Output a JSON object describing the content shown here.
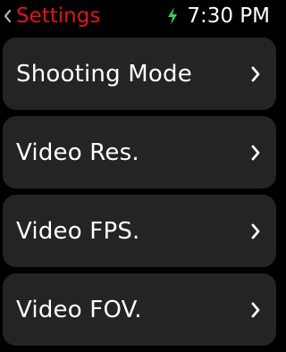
{
  "colors": {
    "background": "#000000",
    "accent": "#e0141e",
    "charging": "#35d35a",
    "text": "#ffffff",
    "row_background": "#242424",
    "chevron": "#ffffff"
  },
  "status_bar": {
    "back_label": "Settings",
    "back_icon": "chevron-left-icon",
    "charging_icon": "bolt-icon",
    "time": "7:30 PM"
  },
  "menu": {
    "items": [
      {
        "label": "Shooting Mode",
        "icon": "chevron-right-icon"
      },
      {
        "label": "Video Res.",
        "icon": "chevron-right-icon"
      },
      {
        "label": "Video FPS.",
        "icon": "chevron-right-icon"
      },
      {
        "label": "Video FOV.",
        "icon": "chevron-right-icon"
      }
    ]
  }
}
